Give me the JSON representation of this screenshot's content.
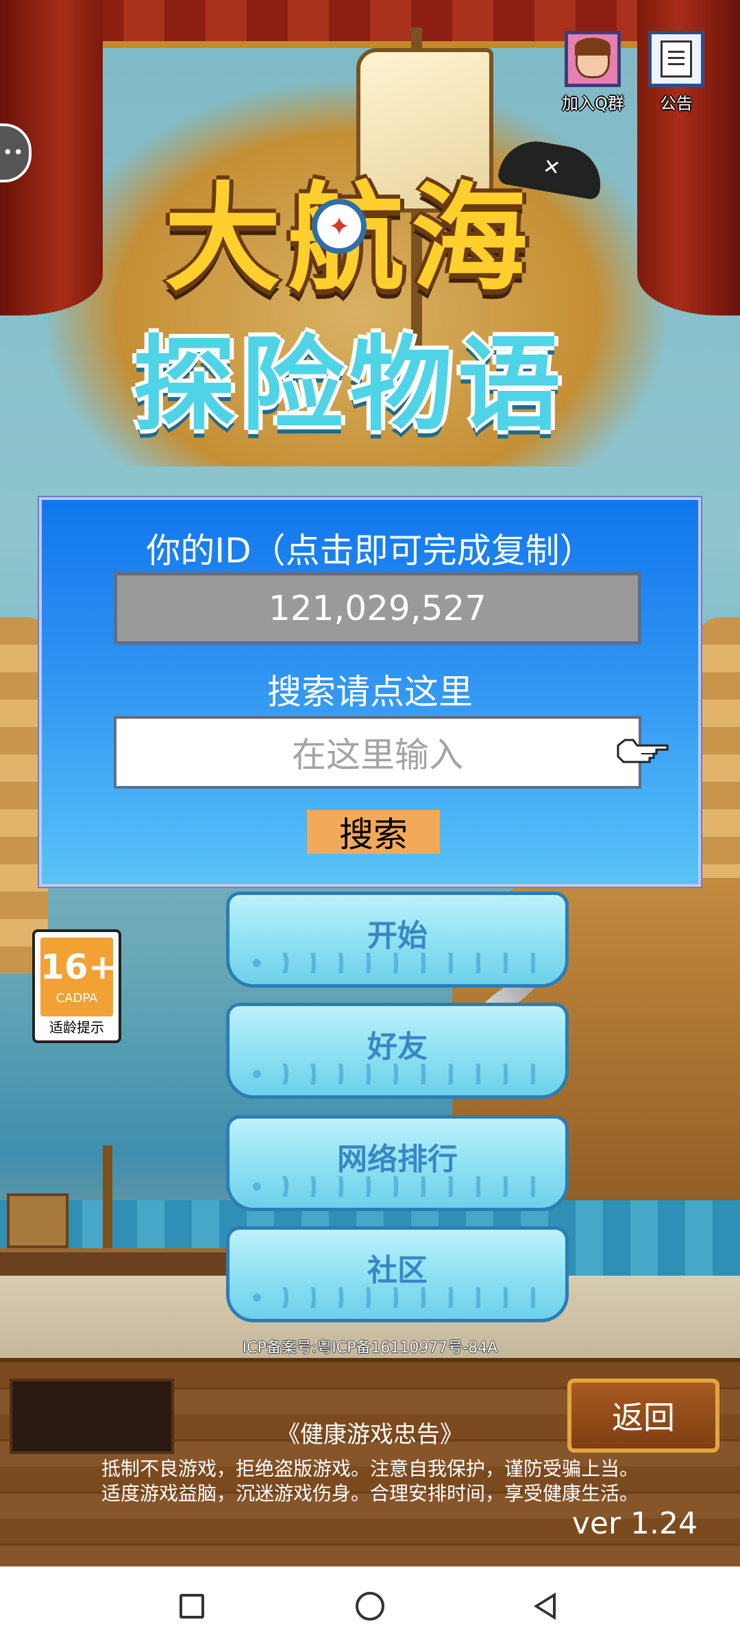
{
  "top_buttons": {
    "join_qq_label": "加入Q群",
    "notice_label": "公告"
  },
  "panel": {
    "title": "你的ID（点击即可完成复制）",
    "id_value": "121,029,527",
    "search_label": "搜索请点这里",
    "search_placeholder": "在这里输入",
    "search_button": "搜索"
  },
  "menu": {
    "start": "开始",
    "friends": "好友",
    "ranking": "网络排行",
    "community": "社区"
  },
  "age_badge": {
    "rating": "16+",
    "org": "CADPA",
    "tip": "适龄提示"
  },
  "icp": "ICP备案号:粤ICP备16110977号-84A",
  "footer": {
    "back_button": "返回",
    "health_title": "《健康游戏忠告》",
    "health_line1": "抵制不良游戏，拒绝盗版游戏。注意自我保护，谨防受骗上当。",
    "health_line2": "适度游戏益脑，沉迷游戏伤身。合理安排时间，享受健康生活。",
    "version": "ver 1.24"
  },
  "logo": {
    "line1": "大航海",
    "line2": "探险物语"
  },
  "colors": {
    "panel_top": "#1177ee",
    "panel_bottom": "#59c3f7",
    "search_button": "#f2a95a",
    "menu_text": "#3a86c4",
    "wood": "#7c4a1f"
  }
}
